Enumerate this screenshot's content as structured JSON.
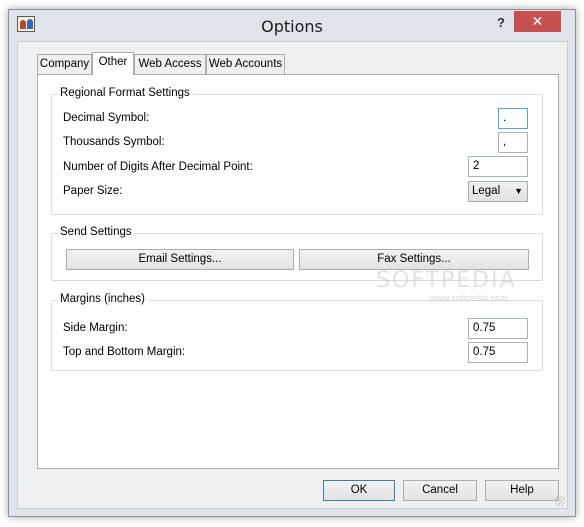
{
  "window": {
    "title": "Options",
    "help_glyph": "?",
    "close_glyph": "✕",
    "app_icon": "people-icon"
  },
  "tabs": [
    {
      "label": "Company",
      "active": false
    },
    {
      "label": "Other",
      "active": true
    },
    {
      "label": "Web Access",
      "active": false
    },
    {
      "label": "Web Accounts",
      "active": false
    }
  ],
  "regional": {
    "title": "Regional Format Settings",
    "decimal_label": "Decimal Symbol:",
    "decimal_value": ".",
    "thousands_label": "Thousands Symbol:",
    "thousands_value": ",",
    "digits_label": "Number of Digits After Decimal Point:",
    "digits_value": "2",
    "paper_label": "Paper Size:",
    "paper_value": "Legal"
  },
  "send": {
    "title": "Send Settings",
    "email_button": "Email Settings...",
    "fax_button": "Fax Settings..."
  },
  "margins": {
    "title": "Margins (inches)",
    "side_label": "Side Margin:",
    "side_value": "0.75",
    "topbottom_label": "Top and Bottom Margin:",
    "topbottom_value": "0.75"
  },
  "footer": {
    "ok": "OK",
    "cancel": "Cancel",
    "help": "Help"
  },
  "watermark": {
    "main": "SOFTPEDIA",
    "sub": "www.softpedia.com"
  },
  "colors": {
    "close_button": "#c75050",
    "frame": "#dfe3ea",
    "focus_border": "#5aa0da"
  }
}
